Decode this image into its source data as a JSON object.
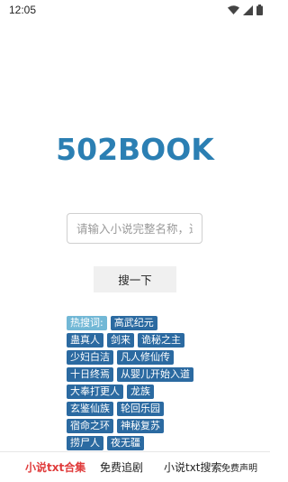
{
  "status_bar": {
    "time": "12:05"
  },
  "logo": {
    "text": "502BOOK"
  },
  "search": {
    "placeholder": "请输入小说完整名称，进",
    "button_label": "搜一下"
  },
  "hot": {
    "label": "热搜词:",
    "rows": [
      [
        "高武纪元"
      ],
      [
        "蛊真人",
        "剑来",
        "诡秘之主"
      ],
      [
        "少妇白洁",
        "凡人修仙传"
      ],
      [
        "十日终焉",
        "从婴儿开始入道"
      ],
      [
        "大奉打更人",
        "龙族"
      ],
      [
        "玄鉴仙族",
        "轮回乐园"
      ],
      [
        "宿命之环",
        "神秘复苏"
      ],
      [
        "捞尸人",
        "夜无疆"
      ]
    ]
  },
  "bottom_nav": {
    "items": [
      "小说txt合集",
      "免费追剧",
      "小说txt搜索",
      "免费声明"
    ],
    "active_color": "#e03b3b"
  },
  "colors": {
    "brand": "#2b7fb3",
    "tag": "#2b6aa1",
    "hot_label": "#72b8d6"
  }
}
